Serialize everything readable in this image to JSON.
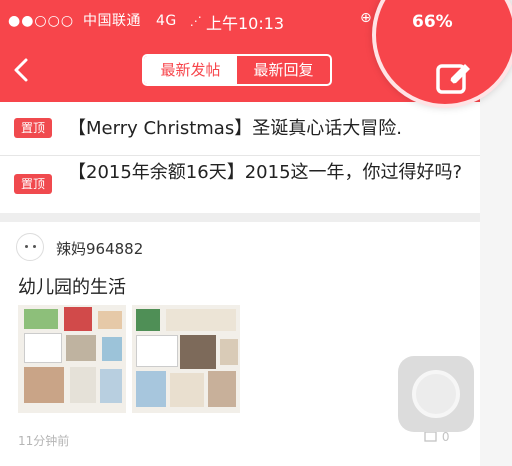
{
  "status_bar": {
    "signal_dots": "●●○○○",
    "carrier": "中国联通",
    "network": "4G",
    "time": "上午10:13",
    "battery": "66%"
  },
  "nav": {
    "tabs": [
      {
        "label": "最新发帖",
        "active": true
      },
      {
        "label": "最新回复",
        "active": false
      }
    ]
  },
  "pinned": [
    {
      "badge": "置顶",
      "title": "【Merry Christmas】圣诞真心话大冒险."
    },
    {
      "badge": "置顶",
      "title": "【2015年余额16天】2015这一年，你过得好吗?"
    }
  ],
  "post": {
    "author": "辣妈964882",
    "title": "幼儿园的生活",
    "time": "11分钟前",
    "comment_count": "0",
    "image_count": 2
  },
  "colors": {
    "brand_red": "#f7454b",
    "badge_red": "#f04a4e"
  },
  "icons": [
    "back-chevron-icon",
    "compose-edit-icon",
    "comment-icon",
    "assistive-touch-icon"
  ]
}
